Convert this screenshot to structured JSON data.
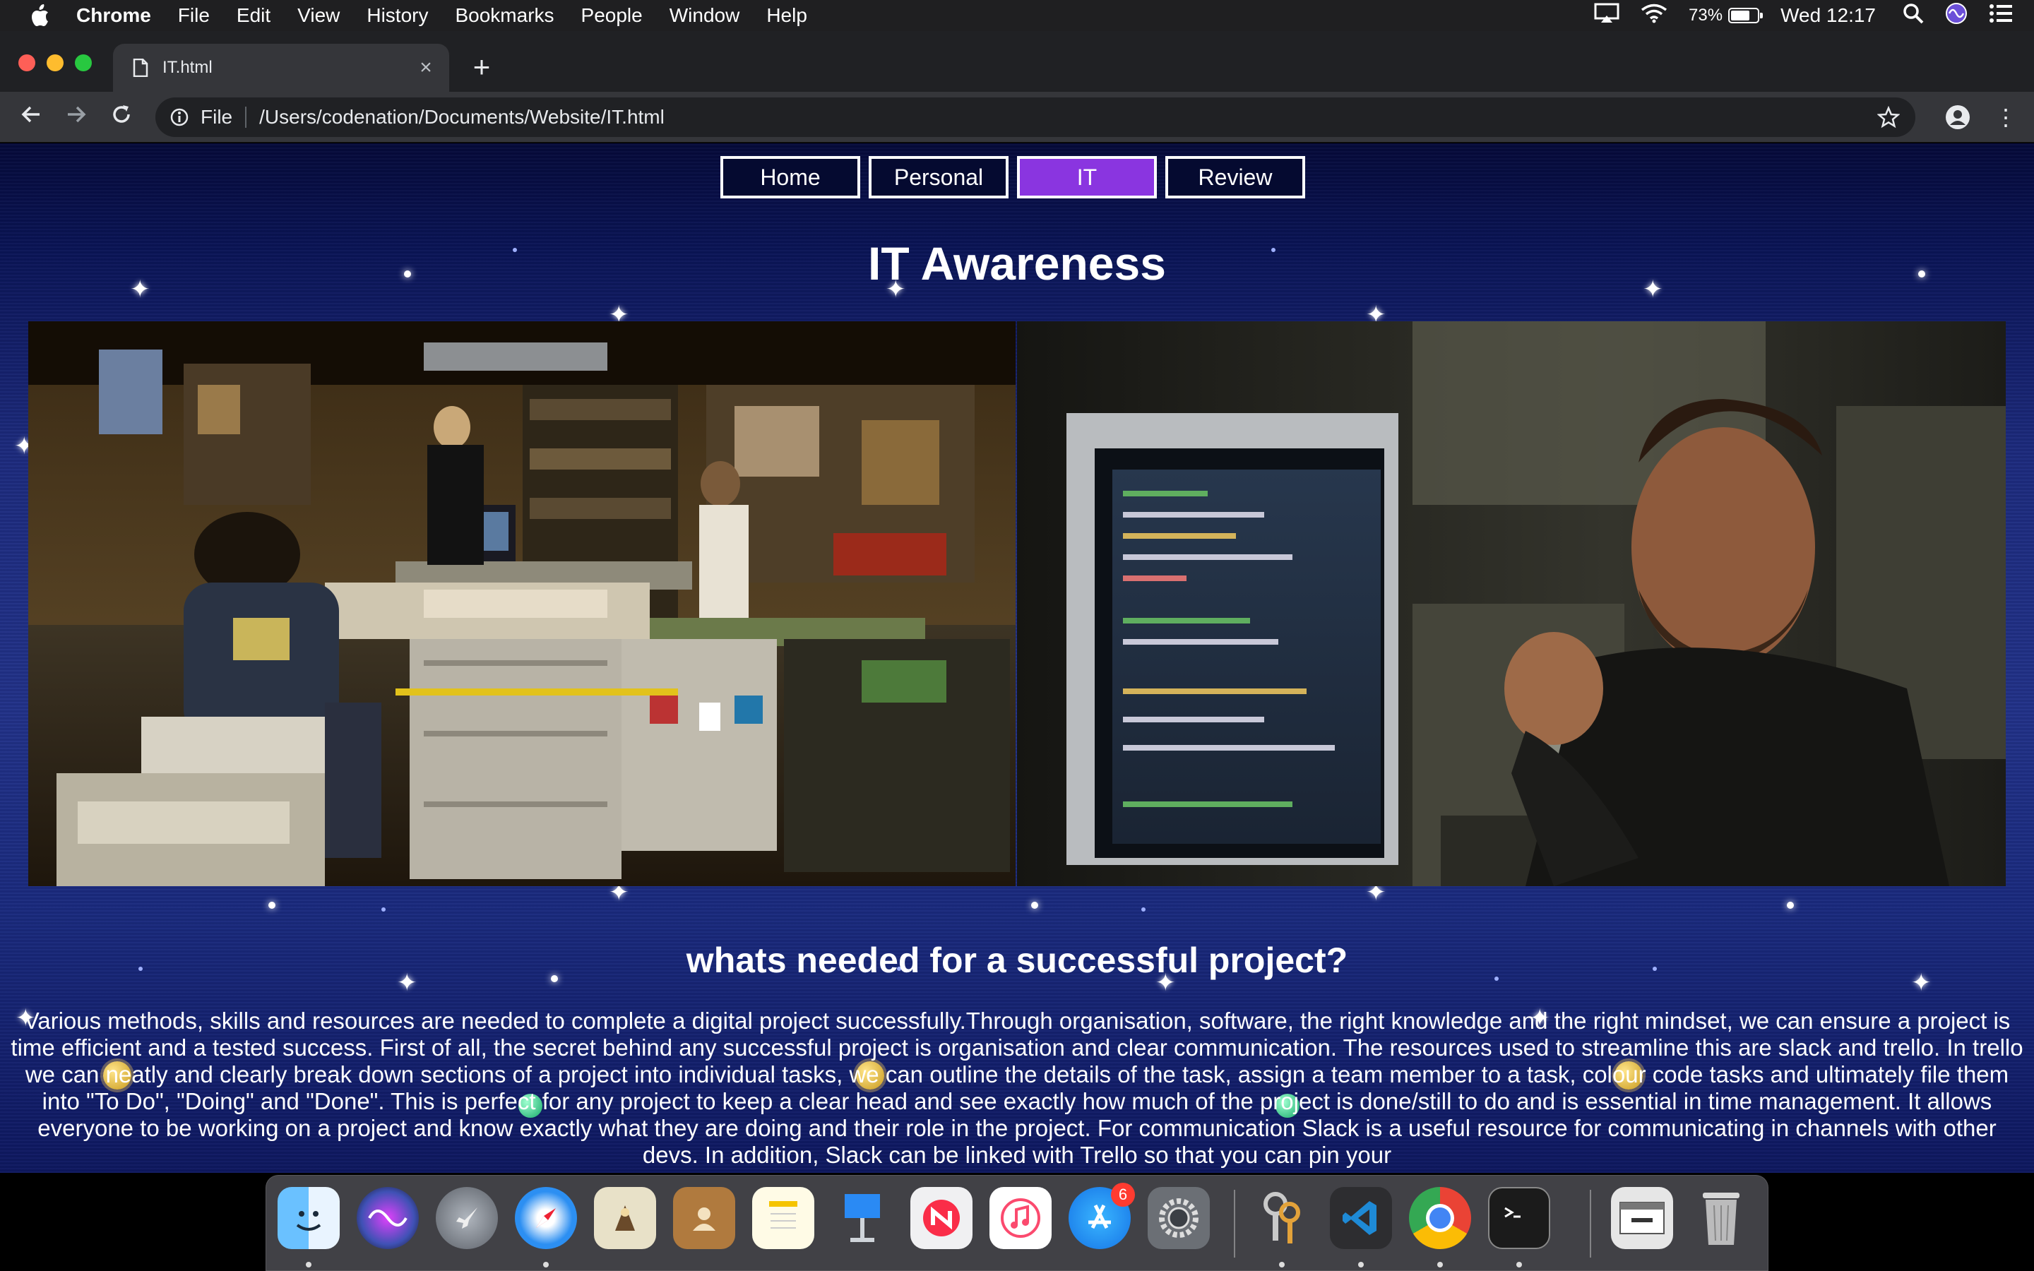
{
  "menubar": {
    "app_name": "Chrome",
    "items": [
      "File",
      "Edit",
      "View",
      "History",
      "Bookmarks",
      "People",
      "Window",
      "Help"
    ],
    "battery_percent": "73%",
    "battery_level": 0.73,
    "clock": "Wed 12:17"
  },
  "browser": {
    "tab_title": "IT.html",
    "scheme_label": "File",
    "url": "/Users/codenation/Documents/Website/IT.html"
  },
  "page": {
    "nav": [
      "Home",
      "Personal",
      "IT",
      "Review"
    ],
    "active_nav": "IT",
    "title": "IT Awareness",
    "section_title": "whats needed for a successful project?",
    "body": "Various methods, skills and resources are needed to complete a digital project successfully.Through organisation, software, the right knowledge and the right mindset, we can ensure a project is time efficient and a tested success. First of all, the secret behind any successful project is organisation and clear communication. The resources used to streamline this are slack and trello. In trello we can neatly and clearly break down sections of a project into individual tasks, we can outline the details of the task, assign a team member to a task, colour code tasks and ultimately file them into \"To Do\", \"Doing\" and \"Done\". This is perfect for any project to keep a clear head and see exactly how much of the project is done/still to do and is essential in time management. It allows everyone to be working on a project and know exactly what they are doing and their role in the project. For communication Slack is a useful resource for communicating in channels with other devs. In addition, Slack can be linked with Trello so that you can pin your",
    "colors": {
      "active_nav": "#8a35e0",
      "background_top": "#050a3a",
      "background_mid": "#223289"
    }
  },
  "dock": {
    "icons": [
      "finder-icon",
      "siri-icon",
      "launchpad-icon",
      "safari-icon",
      "mail-icon",
      "contacts-icon",
      "notes-icon",
      "keynote-icon",
      "news-icon",
      "music-icon",
      "app-store-icon",
      "system-preferences-icon",
      "keychain-icon",
      "vscode-icon",
      "chrome-icon",
      "terminal-icon",
      "downloads-stack-icon",
      "trash-icon"
    ],
    "app_store_badge": "6"
  }
}
